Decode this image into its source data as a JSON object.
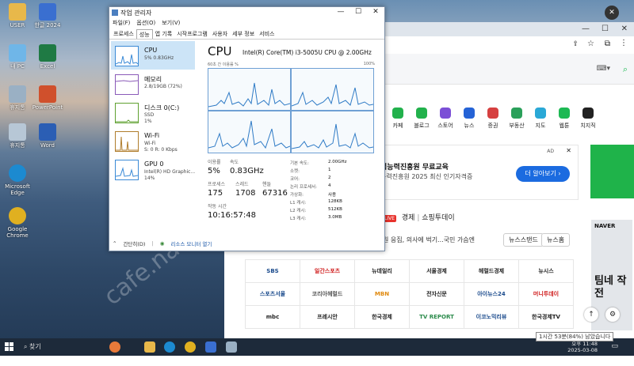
{
  "desktop": {
    "icons": [
      {
        "label": "USER",
        "color": "#e8b84a"
      },
      {
        "label": "한글 2024",
        "color": "#3a6fd0"
      },
      {
        "label": "내 PC",
        "color": "#6fb6e8"
      },
      {
        "label": "Excel",
        "color": "#1f7a44"
      },
      {
        "label": "휴지통",
        "color": "#9ab0c4"
      },
      {
        "label": "PowerPoint",
        "color": "#d0502c"
      },
      {
        "label": "휴지통",
        "color": "#b7c7d6"
      },
      {
        "label": "Word",
        "color": "#2b5eb4"
      },
      {
        "label": "Microsoft Edge",
        "color": "#1c8ad0"
      },
      {
        "label": "Google Chrome",
        "color": "#e0b020"
      }
    ],
    "watermark": "cafe.naver.com/joonggonara"
  },
  "taskmgr": {
    "title": "작업 관리자",
    "menu": [
      "파일(F)",
      "옵션(O)",
      "보기(V)"
    ],
    "tabs": [
      "프로세스",
      "성능",
      "앱 기록",
      "시작프로그램",
      "사용자",
      "세부 정보",
      "서비스"
    ],
    "sidebar": [
      {
        "name": "CPU",
        "d1": "5% 0.83GHz",
        "d2": "",
        "color": "#3a8ad6"
      },
      {
        "name": "메모리",
        "d1": "2.8/19GB (72%)",
        "d2": "",
        "color": "#8a5ab8"
      },
      {
        "name": "디스크 0(C:)",
        "d1": "SSD",
        "d2": "1%",
        "color": "#5fa030"
      },
      {
        "name": "Wi-Fi",
        "d1": "Wi-Fi",
        "d2": "S: 0 R: 0 Kbps",
        "color": "#b07d2c"
      },
      {
        "name": "GPU 0",
        "d1": "Intel(R) HD Graphic...",
        "d2": "14%",
        "color": "#3a8ad6"
      }
    ],
    "cpu": {
      "heading": "CPU",
      "model": "Intel(R) Core(TM) i3-5005U CPU @ 2.00GHz",
      "util_label": "60초 간 이용률 %",
      "pct_label": "100%",
      "stats": [
        {
          "label": "이용률",
          "value": "5%"
        },
        {
          "label": "속도",
          "value": "0.83GHz"
        },
        {
          "label": "프로세스",
          "value": "175"
        },
        {
          "label": "스레드",
          "value": "1708"
        },
        {
          "label": "핸들",
          "value": "67316"
        },
        {
          "label": "작동 시간",
          "value": "10:16:57:48"
        }
      ],
      "info": [
        {
          "label": "기본 속도:",
          "value": "2.00GHz"
        },
        {
          "label": "소켓:",
          "value": "1"
        },
        {
          "label": "코어:",
          "value": "2"
        },
        {
          "label": "논리 프로세서:",
          "value": "4"
        },
        {
          "label": "가상화:",
          "value": "사용"
        },
        {
          "label": "L1 캐시:",
          "value": "128KB"
        },
        {
          "label": "L2 캐시:",
          "value": "512KB"
        },
        {
          "label": "L3 캐시:",
          "value": "3.0MB"
        }
      ]
    },
    "footer": {
      "simple": "간단히(D)",
      "monitor": "리소스 모니터 열기"
    }
  },
  "browser": {
    "shortcuts": [
      {
        "label": "카페",
        "color": "#22b14c"
      },
      {
        "label": "블로그",
        "color": "#22b14c"
      },
      {
        "label": "스토어",
        "color": "#7b4fd6"
      },
      {
        "label": "뉴스",
        "color": "#2563d6"
      },
      {
        "label": "증권",
        "color": "#d64040"
      },
      {
        "label": "부동산",
        "color": "#2aa05a"
      },
      {
        "label": "지도",
        "color": "#2aa8d6"
      },
      {
        "label": "웹툰",
        "color": "#1db954"
      },
      {
        "label": "치지직",
        "color": "#222222"
      }
    ],
    "ad": {
      "tag": "AD",
      "title": "업능력진흥원 무료교육",
      "sub": "능력진흥원 2025 최신 인기자격증",
      "button": "더 알아보기 ›"
    },
    "news": {
      "live": "LIVE",
      "tabs": [
        "경제",
        "쇼핑투데이"
      ],
      "headline": "원 응집, 의사에 벅기...국민 가슴엔",
      "btn1": "뉴스스탠드",
      "btn2": "뉴스홈"
    },
    "logos": [
      "SBS",
      "일간스포츠",
      "뉴데일리",
      "서울경제",
      "헤럴드경제",
      "뉴시스",
      "스포츠서울",
      "코리아헤럴드",
      "MBN",
      "전자신문",
      "아이뉴스24",
      "머니투데이",
      "mbc",
      "프레시안",
      "한국경제",
      "TV REPORT",
      "이코노믹리뷰",
      "한국경제TV"
    ],
    "right_ad": "팀네 작전",
    "right_ad_tag": "NAVER"
  },
  "taskbar": {
    "search": "찾기",
    "time": "오후 11:48",
    "date": "2025-03-08",
    "tooltip": "1시간 53분(84%) 남았습니다"
  }
}
